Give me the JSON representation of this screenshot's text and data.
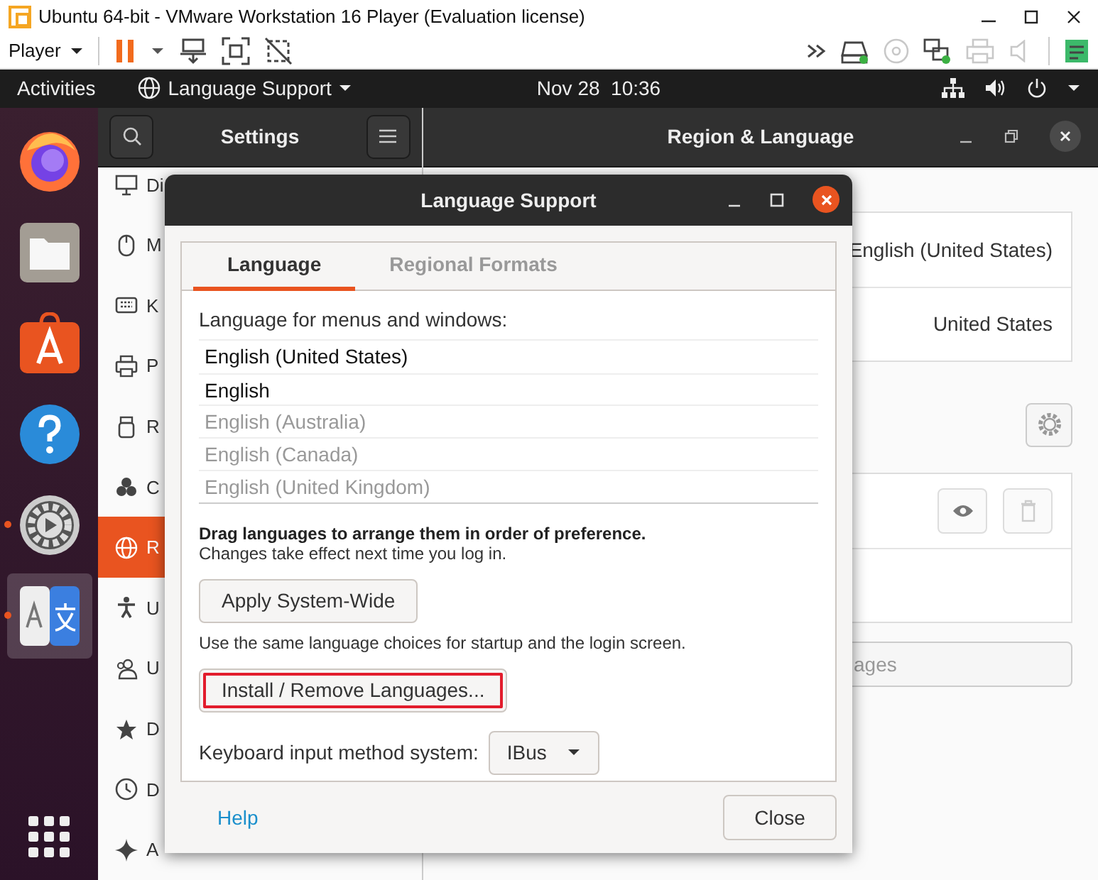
{
  "vm_window": {
    "title": "Ubuntu 64-bit - VMware Workstation 16 Player (Evaluation license)"
  },
  "vm_toolbar": {
    "player_menu": "Player",
    "left_icons": [
      {
        "kind": "pause"
      },
      {
        "kind": "caret"
      },
      {
        "kind": "send-keys"
      },
      {
        "kind": "fullscreen"
      },
      {
        "kind": "unity"
      }
    ],
    "right_icons": [
      {
        "kind": "more",
        "disabled": false
      },
      {
        "kind": "disk",
        "disabled": false
      },
      {
        "kind": "cd",
        "disabled": true
      },
      {
        "kind": "network",
        "disabled": false
      },
      {
        "kind": "printer",
        "disabled": true
      },
      {
        "kind": "sound",
        "disabled": true
      },
      {
        "kind": "notes",
        "disabled": false
      }
    ]
  },
  "top_bar": {
    "activities": "Activities",
    "app_menu": "Language Support",
    "clock": "Nov 28  10:36"
  },
  "dock": {
    "items": [
      {
        "kind": "firefox",
        "running": false,
        "selected": false
      },
      {
        "kind": "files",
        "running": false,
        "selected": false
      },
      {
        "kind": "software",
        "running": false,
        "selected": false
      },
      {
        "kind": "help",
        "running": false,
        "selected": false
      },
      {
        "kind": "settings",
        "running": true,
        "selected": false
      },
      {
        "kind": "language",
        "running": true,
        "selected": true
      }
    ]
  },
  "settings": {
    "title": "Settings",
    "sidebar": [
      {
        "kind": "display",
        "label": "Di",
        "selected": false
      },
      {
        "kind": "mouse",
        "label": "M",
        "selected": false
      },
      {
        "kind": "keyboard",
        "label": "K",
        "selected": false
      },
      {
        "kind": "printer",
        "label": "P",
        "selected": false
      },
      {
        "kind": "removable",
        "label": "R",
        "selected": false
      },
      {
        "kind": "color",
        "label": "C",
        "selected": false
      },
      {
        "kind": "region",
        "label": "R",
        "selected": true
      },
      {
        "kind": "accessibility",
        "label": "U",
        "selected": false
      },
      {
        "kind": "users",
        "label": "U",
        "selected": false
      },
      {
        "kind": "star",
        "label": "D",
        "selected": false
      },
      {
        "kind": "clock",
        "label": "D",
        "selected": false
      },
      {
        "kind": "sparkle",
        "label": "A",
        "selected": false
      }
    ],
    "page_title": "Region & Language",
    "rows": [
      {
        "value": "English (United States)"
      },
      {
        "value": "United States"
      }
    ],
    "manage_text": "ages"
  },
  "dialog": {
    "title": "Language Support",
    "tabs": [
      {
        "label": "Language",
        "selected": true
      },
      {
        "label": "Regional Formats",
        "selected": false
      }
    ],
    "list_label": "Language for menus and windows:",
    "languages": [
      {
        "name": "English (United States)",
        "disabled": false
      },
      {
        "name": "English",
        "disabled": false
      },
      {
        "name": "English (Australia)",
        "disabled": true
      },
      {
        "name": "English (Canada)",
        "disabled": true
      },
      {
        "name": "English (United Kingdom)",
        "disabled": true
      }
    ],
    "hint_bold": "Drag languages to arrange them in order of preference.",
    "hint": "Changes take effect next time you log in.",
    "apply_button": "Apply System-Wide",
    "apply_note": "Use the same language choices for startup and the login screen.",
    "install_button": {
      "label": "Install / Remove Languages...",
      "highlighted": true
    },
    "input_label": "Keyboard input method system:",
    "input_method": "IBus",
    "help": "Help",
    "close": "Close"
  }
}
